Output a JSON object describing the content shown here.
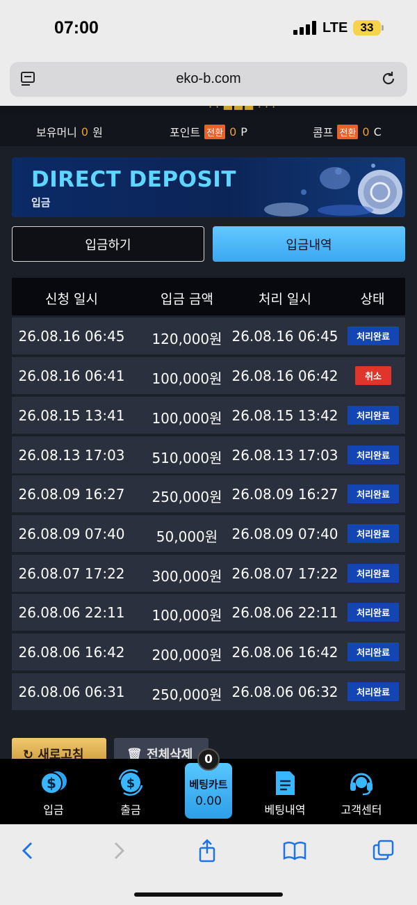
{
  "status_bar": {
    "time": "07:00",
    "network": "LTE",
    "battery": "33"
  },
  "browser": {
    "url": "eko-b.com"
  },
  "wallet": {
    "money_label": "보유머니",
    "money_value": "0",
    "money_unit": "원",
    "point_label": "포인트",
    "point_convert": "전환",
    "point_value": "0",
    "point_unit": "P",
    "comp_label": "콤프",
    "comp_convert": "전환",
    "comp_value": "0",
    "comp_unit": "C"
  },
  "banner": {
    "title": "DIRECT DEPOSIT",
    "subtitle": "입금"
  },
  "tabs": {
    "deposit": "입금하기",
    "history": "입금내역"
  },
  "table": {
    "headers": [
      "신청 일시",
      "입금 금액",
      "처리 일시",
      "상태"
    ],
    "rows": [
      {
        "requested": "26.08.16 06:45",
        "amount": "120,000원",
        "processed": "26.08.16 06:45",
        "status": "처리완료"
      },
      {
        "requested": "26.08.16 06:41",
        "amount": "100,000원",
        "processed": "26.08.16 06:42",
        "status": "취소"
      },
      {
        "requested": "26.08.15 13:41",
        "amount": "100,000원",
        "processed": "26.08.15 13:42",
        "status": "처리완료"
      },
      {
        "requested": "26.08.13 17:03",
        "amount": "510,000원",
        "processed": "26.08.13 17:03",
        "status": "처리완료"
      },
      {
        "requested": "26.08.09 16:27",
        "amount": "250,000원",
        "processed": "26.08.09 16:27",
        "status": "처리완료"
      },
      {
        "requested": "26.08.09 07:40",
        "amount": "50,000원",
        "processed": "26.08.09 07:40",
        "status": "처리완료"
      },
      {
        "requested": "26.08.07 17:22",
        "amount": "300,000원",
        "processed": "26.08.07 17:22",
        "status": "처리완료"
      },
      {
        "requested": "26.08.06 22:11",
        "amount": "100,000원",
        "processed": "26.08.06 22:11",
        "status": "처리완료"
      },
      {
        "requested": "26.08.06 16:42",
        "amount": "200,000원",
        "processed": "26.08.06 16:42",
        "status": "처리완료"
      },
      {
        "requested": "26.08.06 06:31",
        "amount": "250,000원",
        "processed": "26.08.06 06:32",
        "status": "처리완료"
      }
    ]
  },
  "actions": {
    "refresh": "새로고침",
    "delete_all": "전체삭제"
  },
  "bottom_nav": {
    "deposit": "입금",
    "withdraw": "출금",
    "bet_cart_label": "베팅카트",
    "bet_cart_value": "0.00",
    "bet_cart_count": "0",
    "bet_history": "베팅내역",
    "support": "고객센터"
  },
  "colors": {
    "accent": "#3aa7f0",
    "done_badge": "#1446b3",
    "cancel_badge": "#e0352b",
    "highlight": "#f0a030"
  }
}
